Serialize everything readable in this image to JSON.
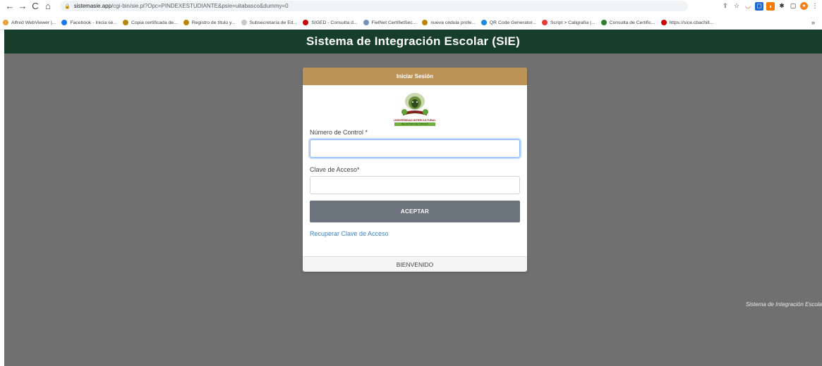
{
  "browser": {
    "url_domain": "sistemasie.app",
    "url_path": "/cgi-bin/sie.pl?Opc=PINDEXESTUDIANTE&psie=uitabasco&dummy=0",
    "bookmarks": [
      {
        "label": "Alfred WebViewer |...",
        "color": "#e8a33c"
      },
      {
        "label": "Facebook - Inicia se...",
        "color": "#1877f2"
      },
      {
        "label": "Copia certificada de...",
        "color": "#b8860b"
      },
      {
        "label": "Registro de título y...",
        "color": "#b8860b"
      },
      {
        "label": "Subsecretaría de Ed...",
        "color": "#c8c8c8"
      },
      {
        "label": "SIGED - Consulta d...",
        "color": "#cc0000"
      },
      {
        "label": "FielNet CertifielSec...",
        "color": "#7a8fb5"
      },
      {
        "label": "nueva cédula profe...",
        "color": "#b8860b"
      },
      {
        "label": "QR Code Generator...",
        "color": "#1e88e5"
      },
      {
        "label": "Script > Caligrafía |...",
        "color": "#e53935"
      },
      {
        "label": "Consulta de Certific...",
        "color": "#2e7d32"
      },
      {
        "label": "https://sice.cbachill...",
        "color": "#cc0000"
      }
    ],
    "bookmarks_more": "»"
  },
  "header": {
    "title": "Sistema de Integración Escolar (SIE)"
  },
  "login": {
    "card_title": "Iniciar Sesión",
    "logo_text_top": "UNIVERSIDAD INTERCULTURAL",
    "logo_text_bottom": "DEL ESTADO DE TABASCO",
    "control_label": "Número de Control *",
    "control_value": "",
    "password_label": "Clave de Acceso*",
    "password_value": "",
    "submit_label": "ACEPTAR",
    "recover_link": "Recuperar Clave de Acceso",
    "footer": "BIENVENIDO"
  },
  "footer_text": "Sistema de Integración Escola",
  "colors": {
    "header_bg": "#173d2b",
    "card_header_bg": "#bc9458",
    "stage_bg": "#707070",
    "button_bg": "#6c757d",
    "link": "#3b82c4"
  }
}
